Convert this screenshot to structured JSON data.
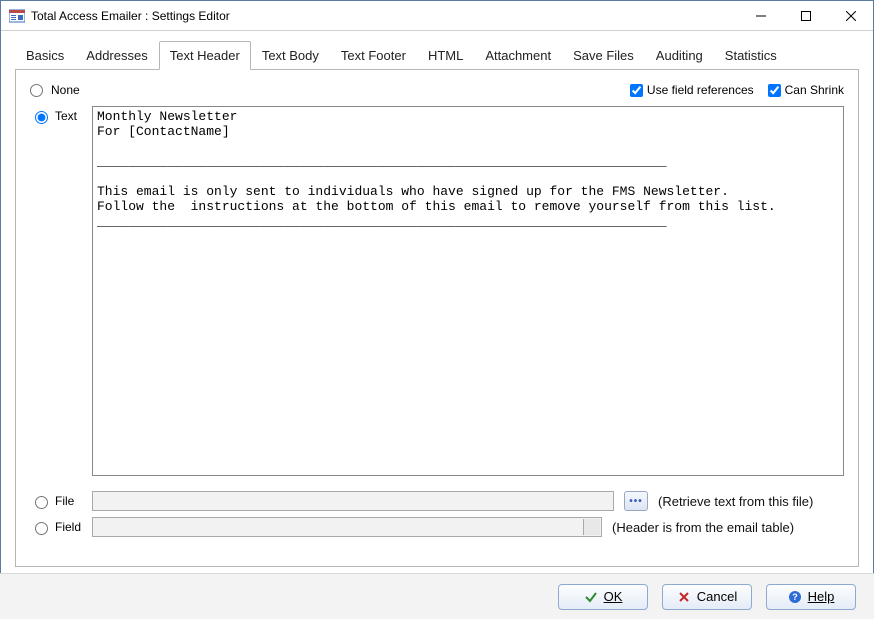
{
  "window": {
    "title": "Total Access Emailer : Settings Editor"
  },
  "tabs": [
    {
      "label": "Basics"
    },
    {
      "label": "Addresses"
    },
    {
      "label": "Text Header",
      "active": true
    },
    {
      "label": "Text Body"
    },
    {
      "label": "Text Footer"
    },
    {
      "label": "HTML"
    },
    {
      "label": "Attachment"
    },
    {
      "label": "Save Files"
    },
    {
      "label": "Auditing"
    },
    {
      "label": "Statistics"
    }
  ],
  "options": {
    "none_label": "None",
    "text_label": "Text",
    "file_label": "File",
    "field_label": "Field",
    "selected": "text",
    "use_field_refs_label": "Use field references",
    "use_field_refs_checked": true,
    "can_shrink_label": "Can Shrink",
    "can_shrink_checked": true
  },
  "text_content": "Monthly Newsletter\nFor [ContactName]\n\n_________________________________________________________________________\n\nThis email is only sent to individuals who have signed up for the FMS Newsletter.\nFollow the  instructions at the bottom of this email to remove yourself from this list.\n_________________________________________________________________________",
  "file_row": {
    "value": "",
    "browse_tooltip": "Browse",
    "desc": "(Retrieve text from this file)"
  },
  "field_row": {
    "value": "",
    "desc": "(Header is from the email table)"
  },
  "footer": {
    "ok": "OK",
    "cancel": "Cancel",
    "help": "Help"
  }
}
